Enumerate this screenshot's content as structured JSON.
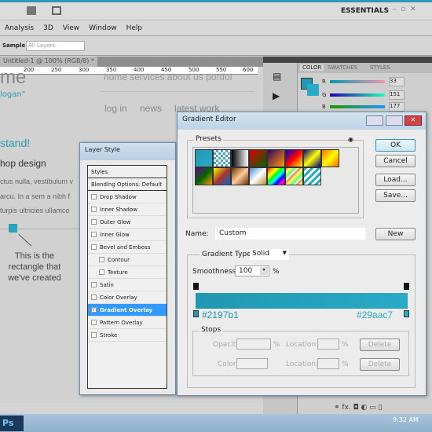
{
  "app": {
    "workspace": "ESSENTIALS",
    "menu": [
      "Analysis",
      "3D",
      "View",
      "Window",
      "Help"
    ],
    "sample_label": "Sample:",
    "sample_value": "All Layers"
  },
  "document": {
    "tab": "Untitled-1 @ 100% (RGB/8) *",
    "ruler": [
      "200",
      "250",
      "300",
      "350",
      "400",
      "450",
      "500",
      "550",
      "600"
    ],
    "canvas": {
      "nav_top": "home   services   about us   portfol",
      "title_fragment": "me",
      "slogan_fragment": "logan\"",
      "nav": [
        "log in",
        "news",
        "latest work"
      ],
      "heading": "stand!",
      "subheading": "hop design",
      "body_lines": [
        "ctus nulla, vestibulum v",
        "arcu. In a sem a nibh f",
        "turpis ultricies ullamco"
      ],
      "annotation": "This is the rectangle that we've created"
    }
  },
  "color_panel": {
    "tabs": [
      "COLOR",
      "SWATCHES",
      "STYLES"
    ],
    "r": "33",
    "g": "151",
    "b": "177",
    "fg": "#2197b1"
  },
  "layer_style": {
    "title": "Layer Style",
    "styles": "Styles",
    "blending": "Blending Options: Default",
    "items": [
      {
        "label": "Drop Shadow",
        "checked": false
      },
      {
        "label": "Inner Shadow",
        "checked": false
      },
      {
        "label": "Outer Glow",
        "checked": false
      },
      {
        "label": "Inner Glow",
        "checked": false
      },
      {
        "label": "Bevel and Emboss",
        "checked": false
      },
      {
        "label": "Contour",
        "checked": false,
        "sub": true
      },
      {
        "label": "Texture",
        "checked": false,
        "sub": true
      },
      {
        "label": "Satin",
        "checked": false
      },
      {
        "label": "Color Overlay",
        "checked": false
      },
      {
        "label": "Gradient Overlay",
        "checked": true,
        "selected": true
      },
      {
        "label": "Pattern Overlay",
        "checked": false
      },
      {
        "label": "Stroke",
        "checked": false
      }
    ]
  },
  "gradient_editor": {
    "title": "Gradient Editor",
    "presets_label": "Presets",
    "ok": "OK",
    "cancel": "Cancel",
    "load": "Load...",
    "save": "Save...",
    "new": "New",
    "name_label": "Name:",
    "name_value": "Custom",
    "type_label": "Gradient Type:",
    "type_value": "Solid",
    "smooth_label": "Smoothness:",
    "smooth_value": "100",
    "pct": "%",
    "start_color": "#2197b1",
    "end_color": "#29aac7",
    "start_label": "#2197b1",
    "end_label": "#29aac7",
    "stops_label": "Stops",
    "opacity_label": "Opacity:",
    "color_label": "Color:",
    "location_label": "Location:",
    "delete": "Delete",
    "presets": [
      "linear-gradient(135deg,#2197b1,#29aac7)",
      "repeating-conic-gradient(#4aa8c8 0 25%,#fff 0 50%) 0 0/6px 6px",
      "linear-gradient(90deg,#000,#fff)",
      "linear-gradient(135deg,#d00,#060)",
      "linear-gradient(135deg,#306,#f90)",
      "linear-gradient(135deg,#00c,#f00,#ff0)",
      "linear-gradient(135deg,#008,#ff0,#008)",
      "linear-gradient(135deg,#f60,#ff0,#f60)",
      "linear-gradient(135deg,#609,#060,#f90)",
      "linear-gradient(135deg,#ff0,#a33,#06c)",
      "linear-gradient(135deg,#630,#fc9,#630)",
      "linear-gradient(135deg,#48c,#fff,#b83)",
      "linear-gradient(135deg,red,orange,yellow,lime,cyan,blue,magenta,red)",
      "repeating-linear-gradient(135deg,#f66,#ff6 4px,#6f6 8px,#fff 12px)",
      "repeating-linear-gradient(135deg,#29aac7 0 3px,#fff 3px 6px)"
    ]
  },
  "taskbar": {
    "time": "9:32 AM",
    "ps": "Ps"
  }
}
